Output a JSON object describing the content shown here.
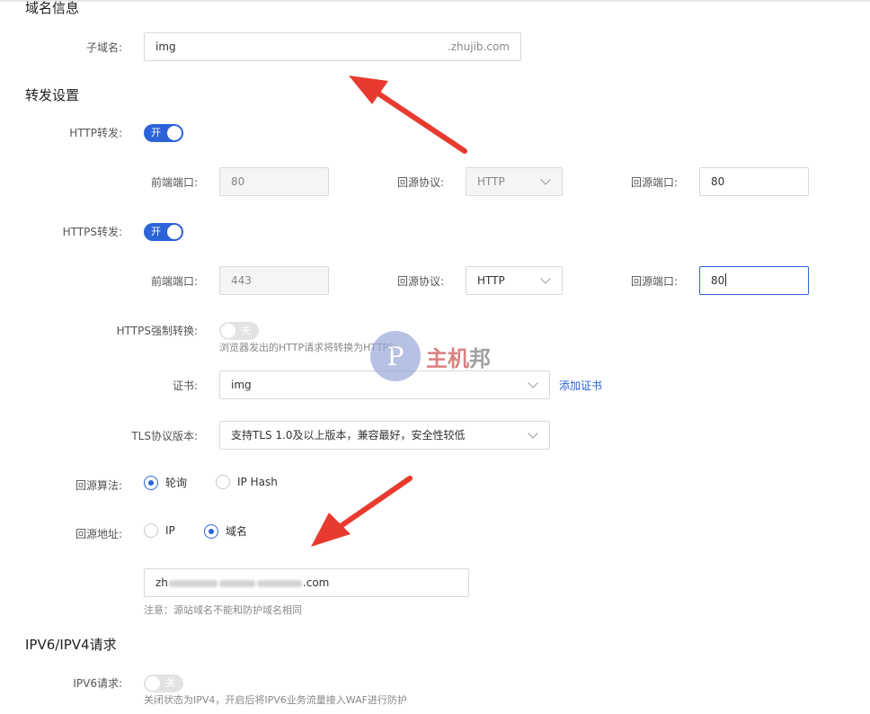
{
  "domain_info": {
    "title": "域名信息",
    "subdomain_label": "子域名:",
    "subdomain_value": "img",
    "subdomain_suffix": ".zhujib.com"
  },
  "forward": {
    "title": "转发设置",
    "http_label": "HTTP转发:",
    "http_toggle": "开",
    "https_label": "HTTPS转发:",
    "https_toggle": "开",
    "front_port_label": "前端端口:",
    "proto_label": "回源协议:",
    "origin_port_label": "回源端口:",
    "http_row": {
      "front_port": "80",
      "proto": "HTTP",
      "origin_port": "80"
    },
    "https_row": {
      "front_port": "443",
      "proto": "HTTP",
      "origin_port": "80"
    },
    "force_label": "HTTPS强制转换:",
    "force_toggle": "关",
    "force_hint": "浏览器发出的HTTP请求将转换为HTTPS",
    "cert_label": "证书:",
    "cert_value": "img",
    "add_cert": "添加证书",
    "tls_label": "TLS协议版本:",
    "tls_value": "支持TLS 1.0及以上版本，兼容最好，安全性较低",
    "algo_label": "回源算法:",
    "algo_options": [
      "轮询",
      "IP Hash"
    ],
    "algo_selected": "轮询",
    "addr_label": "回源地址:",
    "addr_options": [
      "IP",
      "域名"
    ],
    "addr_selected": "域名",
    "addr_value_prefix": "zh",
    "addr_value_suffix": ".com",
    "addr_note": "注意：源站域名不能和防护域名相同"
  },
  "ipv6": {
    "title": "IPV6/IPV4请求",
    "label": "IPV6请求:",
    "toggle": "关",
    "hint": "关闭状态为IPV4，开启后将IPV6业务流量接入WAF进行防护"
  },
  "watermark": {
    "glyph": "P",
    "text_red": "主机",
    "text_gray": "邦"
  },
  "colors": {
    "accent": "#2c63d8",
    "arrow": "#e83a2e"
  }
}
